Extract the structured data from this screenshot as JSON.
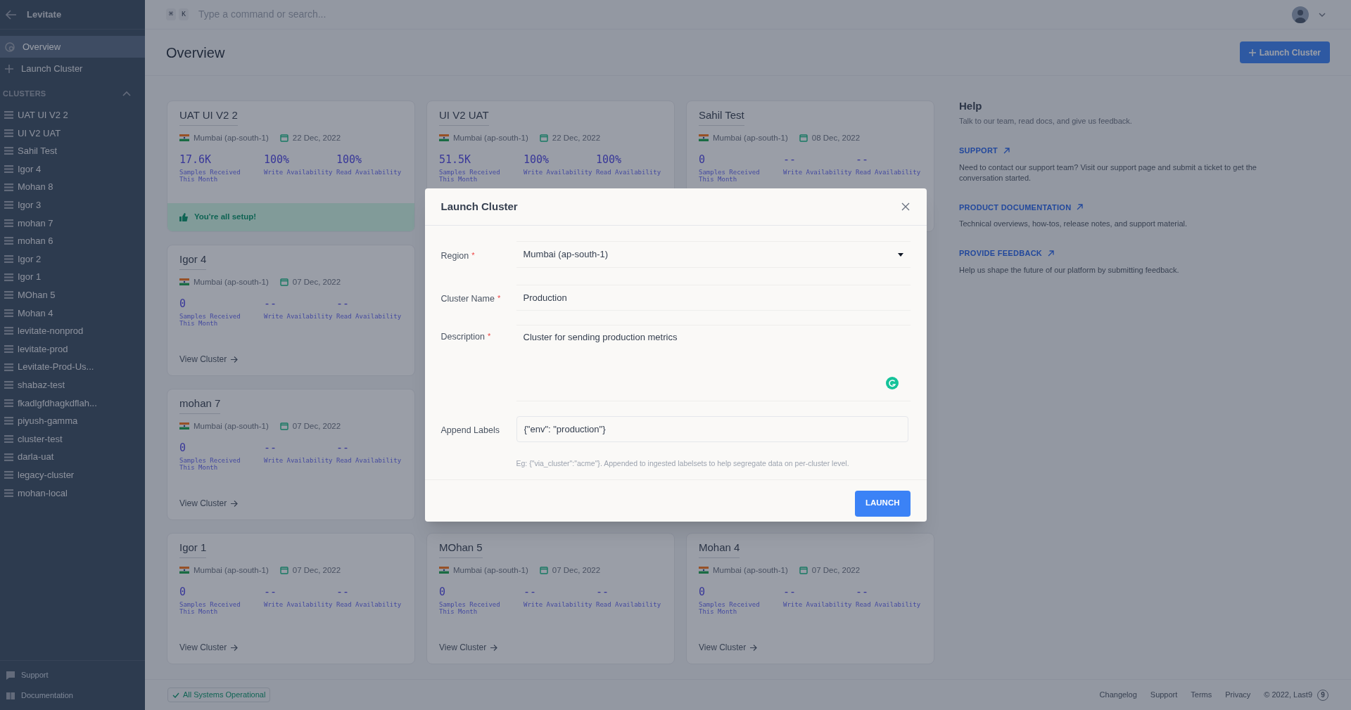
{
  "app": {
    "title": "Levitate"
  },
  "sidebar": {
    "nav": [
      {
        "kind": "overview",
        "label": "Overview",
        "selected": true
      },
      {
        "kind": "add",
        "label": "Launch Cluster",
        "selected": false
      }
    ],
    "section": {
      "title": "CLUSTERS",
      "expanded": true
    },
    "clusters": [
      "UAT UI V2 2",
      "UI V2 UAT",
      "Sahil Test",
      "Igor 4",
      "Mohan 8",
      "Igor 3",
      "mohan 7",
      "mohan 6",
      "Igor 2",
      "Igor 1",
      "MOhan 5",
      "Mohan 4",
      "levitate-nonprod",
      "levitate-prod",
      "Levitate-Prod-Us...",
      "shabaz-test",
      "fkadlgfdhagkdflah...",
      "piyush-gamma",
      "cluster-test",
      "darla-uat",
      "legacy-cluster",
      "mohan-local"
    ],
    "bottom": [
      {
        "kind": "chat",
        "label": "Support"
      },
      {
        "kind": "book",
        "label": "Documentation"
      }
    ]
  },
  "topbar": {
    "shortcut": [
      "⌘",
      "K"
    ],
    "search": {
      "placeholder": "Type a command or search..."
    }
  },
  "page": {
    "title": "Overview",
    "action": "Launch Cluster"
  },
  "card_rows": [
    [
      {
        "name": "UAT UI V2 2",
        "region": "Mumbai (ap-south-1)",
        "date": "22 Dec, 2022",
        "stats": [
          {
            "value": "17.6K",
            "label": "Samples Received This Month"
          },
          {
            "value": "100%",
            "label": "Write Availability"
          },
          {
            "value": "100%",
            "label": "Read Availability"
          }
        ],
        "setup_message": "You're all setup!"
      },
      {
        "name": "UI V2 UAT",
        "region": "Mumbai (ap-south-1)",
        "date": "22 Dec, 2022",
        "stats": [
          {
            "value": "51.5K",
            "label": "Samples Received This Month"
          },
          {
            "value": "100%",
            "label": "Write Availability"
          },
          {
            "value": "100%",
            "label": "Read Availability"
          }
        ]
      },
      {
        "name": "Sahil Test",
        "region": "Mumbai (ap-south-1)",
        "date": "08 Dec, 2022",
        "stats": [
          {
            "value": "0",
            "label": "Samples Received This Month"
          },
          {
            "value": "--",
            "label": "Write Availability"
          },
          {
            "value": "--",
            "label": "Read Availability"
          }
        ]
      }
    ],
    [
      {
        "name": "Igor 4",
        "region": "Mumbai (ap-south-1)",
        "date": "07 Dec, 2022",
        "stats": [
          {
            "value": "0",
            "label": "Samples Received This Month"
          },
          {
            "value": "--",
            "label": "Write Availability"
          },
          {
            "value": "--",
            "label": "Read Availability"
          }
        ],
        "link": "View Cluster"
      }
    ],
    [
      {
        "name": "mohan 7",
        "region": "Mumbai (ap-south-1)",
        "date": "07 Dec, 2022",
        "stats": [
          {
            "value": "0",
            "label": "Samples Received This Month"
          },
          {
            "value": "--",
            "label": "Write Availability"
          },
          {
            "value": "--",
            "label": "Read Availability"
          }
        ],
        "link": "View Cluster"
      }
    ],
    [
      {
        "name": "Igor 1",
        "region": "Mumbai (ap-south-1)",
        "date": "07 Dec, 2022",
        "stats": [
          {
            "value": "0",
            "label": "Samples Received This Month"
          },
          {
            "value": "--",
            "label": "Write Availability"
          },
          {
            "value": "--",
            "label": "Read Availability"
          }
        ],
        "link": "View Cluster"
      },
      {
        "name": "MOhan 5",
        "region": "Mumbai (ap-south-1)",
        "date": "07 Dec, 2022",
        "stats": [
          {
            "value": "0",
            "label": "Samples Received This Month"
          },
          {
            "value": "--",
            "label": "Write Availability"
          },
          {
            "value": "--",
            "label": "Read Availability"
          }
        ],
        "link": "View Cluster"
      },
      {
        "name": "Mohan 4",
        "region": "Mumbai (ap-south-1)",
        "date": "07 Dec, 2022",
        "stats": [
          {
            "value": "0",
            "label": "Samples Received This Month"
          },
          {
            "value": "--",
            "label": "Write Availability"
          },
          {
            "value": "--",
            "label": "Read Availability"
          }
        ],
        "link": "View Cluster"
      }
    ]
  ],
  "help": {
    "title": "Help",
    "subtitle": "Talk to our team, read docs, and give us feedback.",
    "links": [
      {
        "label": "SUPPORT",
        "text": "Need to contact our support team? Visit our support page and submit a ticket to get the conversation started."
      },
      {
        "label": "PRODUCT DOCUMENTATION",
        "text": "Technical overviews, how-tos, release notes, and support material."
      },
      {
        "label": "PROVIDE FEEDBACK",
        "text": "Help us shape the future of our platform by submitting feedback."
      }
    ]
  },
  "modal": {
    "title": "Launch Cluster",
    "required_mark": "*",
    "fields": [
      {
        "kind": "select",
        "label": "Region",
        "required": true,
        "value": "Mumbai (ap-south-1)"
      },
      {
        "kind": "text",
        "label": "Cluster Name",
        "required": true,
        "value": "Production"
      },
      {
        "kind": "textarea",
        "label": "Description",
        "required": true,
        "value": "Cluster for sending production metrics"
      },
      {
        "kind": "boxed",
        "label": "Append Labels",
        "required": false,
        "value": "{\"env\": \"production\"}",
        "hint": "Eg: {\"via_cluster\":\"acme\"}. Appended to ingested labelsets to help segregate data on per-cluster level."
      }
    ],
    "submit": "LAUNCH"
  },
  "footer": {
    "status": "All Systems Operational",
    "links": [
      "Changelog",
      "Support",
      "Terms",
      "Privacy"
    ],
    "copyright": "© 2022, Last9",
    "logo_mark": "9"
  }
}
